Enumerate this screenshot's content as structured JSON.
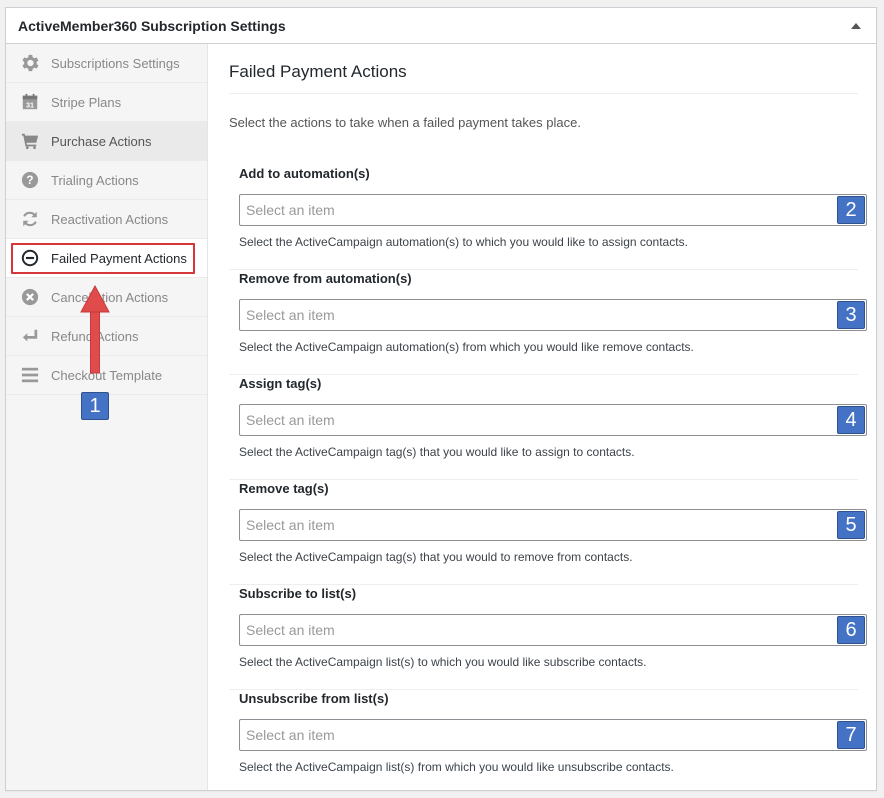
{
  "panel": {
    "title": "ActiveMember360 Subscription Settings"
  },
  "sidebar": {
    "items": [
      {
        "label": "Subscriptions Settings",
        "icon": "gear-icon"
      },
      {
        "label": "Stripe Plans",
        "icon": "calendar-icon"
      },
      {
        "label": "Purchase Actions",
        "icon": "cart-icon"
      },
      {
        "label": "Trialing Actions",
        "icon": "question-icon"
      },
      {
        "label": "Reactivation Actions",
        "icon": "refresh-icon"
      },
      {
        "label": "Failed Payment Actions",
        "icon": "minus-circle-icon"
      },
      {
        "label": "Cancellation Actions",
        "icon": "x-circle-icon"
      },
      {
        "label": "Refund Actions",
        "icon": "return-arrow-icon"
      },
      {
        "label": "Checkout Template",
        "icon": "menu-lines-icon"
      }
    ],
    "active_index": 5,
    "hover_index": 2
  },
  "main": {
    "title": "Failed Payment Actions",
    "description": "Select the actions to take when a failed payment takes place.",
    "fields": [
      {
        "label": "Add to automation(s)",
        "placeholder": "Select an item",
        "help": "Select the ActiveCampaign automation(s) to which you would like to assign contacts.",
        "badge": "2"
      },
      {
        "label": "Remove from automation(s)",
        "placeholder": "Select an item",
        "help": "Select the ActiveCampaign automation(s) from which you would like remove contacts.",
        "badge": "3"
      },
      {
        "label": "Assign tag(s)",
        "placeholder": "Select an item",
        "help": "Select the ActiveCampaign tag(s) that you would like to assign to contacts.",
        "badge": "4"
      },
      {
        "label": "Remove tag(s)",
        "placeholder": "Select an item",
        "help": "Select the ActiveCampaign tag(s) that you would to remove from contacts.",
        "badge": "5"
      },
      {
        "label": "Subscribe to list(s)",
        "placeholder": "Select an item",
        "help": "Select the ActiveCampaign list(s) to which you would like subscribe contacts.",
        "badge": "6"
      },
      {
        "label": "Unsubscribe from list(s)",
        "placeholder": "Select an item",
        "help": "Select the ActiveCampaign list(s) from which you would like unsubscribe contacts.",
        "badge": "7"
      }
    ]
  },
  "annotation": {
    "badge": "1",
    "arrow_color": "#e04b4b",
    "badge_color": "#4472c4"
  }
}
